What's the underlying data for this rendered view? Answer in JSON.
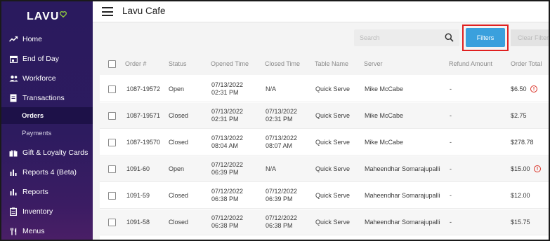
{
  "brand": {
    "logo_text": "LAVU",
    "accent": "#8dc63f"
  },
  "sidebar": {
    "items": [
      {
        "label": "Home",
        "icon": "trend-line-icon"
      },
      {
        "label": "End of Day",
        "icon": "calendar-icon"
      },
      {
        "label": "Workforce",
        "icon": "people-icon"
      },
      {
        "label": "Transactions",
        "icon": "receipt-icon"
      },
      {
        "label": "Gift & Loyalty Cards",
        "icon": "gift-icon"
      },
      {
        "label": "Reports 4 (Beta)",
        "icon": "bar-chart-icon"
      },
      {
        "label": "Reports",
        "icon": "bar-chart-icon"
      },
      {
        "label": "Inventory",
        "icon": "clipboard-icon"
      },
      {
        "label": "Menus",
        "icon": "fork-knife-icon"
      }
    ],
    "sub_items": [
      {
        "label": "Orders",
        "active": true
      },
      {
        "label": "Payments",
        "active": false
      }
    ]
  },
  "header": {
    "title": "Lavu Cafe"
  },
  "toolbar": {
    "search_placeholder": "Search",
    "filters_label": "Filters",
    "clear_label": "Clear Filter"
  },
  "table": {
    "columns": [
      "Order #",
      "Status",
      "Opened Time",
      "Closed Time",
      "Table Name",
      "Server",
      "Refund Amount",
      "Order Total"
    ],
    "rows": [
      {
        "order": "1087-19572",
        "status": "Open",
        "opened_date": "07/13/2022",
        "opened_time": "02:31 PM",
        "closed_date": "N/A",
        "closed_time": "",
        "table": "Quick Serve",
        "server": "Mike McCabe",
        "refund": "-",
        "total": "$6.50",
        "alert": true
      },
      {
        "order": "1087-19571",
        "status": "Closed",
        "opened_date": "07/13/2022",
        "opened_time": "02:31 PM",
        "closed_date": "07/13/2022",
        "closed_time": "02:31 PM",
        "table": "Quick Serve",
        "server": "Mike McCabe",
        "refund": "-",
        "total": "$2.75",
        "alert": false
      },
      {
        "order": "1087-19570",
        "status": "Closed",
        "opened_date": "07/13/2022",
        "opened_time": "08:04 AM",
        "closed_date": "07/13/2022",
        "closed_time": "08:07 AM",
        "table": "Quick Serve",
        "server": "Mike McCabe",
        "refund": "-",
        "total": "$278.78",
        "alert": false
      },
      {
        "order": "1091-60",
        "status": "Open",
        "opened_date": "07/12/2022",
        "opened_time": "06:39 PM",
        "closed_date": "N/A",
        "closed_time": "",
        "table": "Quick Serve",
        "server": "Maheendhar Somarajupalli",
        "refund": "-",
        "total": "$15.00",
        "alert": true
      },
      {
        "order": "1091-59",
        "status": "Closed",
        "opened_date": "07/12/2022",
        "opened_time": "06:38 PM",
        "closed_date": "07/12/2022",
        "closed_time": "06:39 PM",
        "table": "Quick Serve",
        "server": "Maheendhar Somarajupalli",
        "refund": "-",
        "total": "$12.00",
        "alert": false
      },
      {
        "order": "1091-58",
        "status": "Closed",
        "opened_date": "07/12/2022",
        "opened_time": "06:38 PM",
        "closed_date": "07/12/2022",
        "closed_time": "06:38 PM",
        "table": "Quick Serve",
        "server": "Maheendhar Somarajupalli",
        "refund": "-",
        "total": "$15.75",
        "alert": false
      }
    ]
  }
}
